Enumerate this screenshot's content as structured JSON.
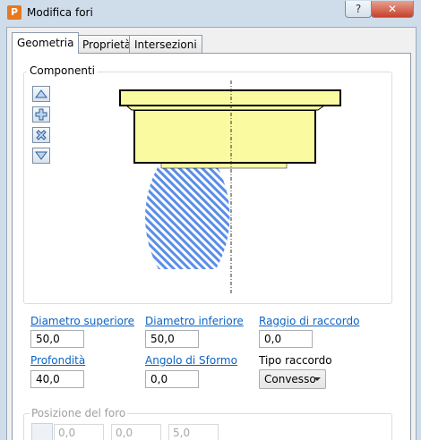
{
  "window": {
    "title": "Modifica fori",
    "app_icon_letter": "P",
    "help_label": "?",
    "close_label": "✕"
  },
  "tabs": [
    {
      "label": "Geometria",
      "active": true
    },
    {
      "label": "Proprietà",
      "active": false
    },
    {
      "label": "Intersezioni",
      "active": false
    }
  ],
  "componenti": {
    "label": "Componenti",
    "toolbar": [
      {
        "icon": "arrow-up-icon"
      },
      {
        "icon": "add-plus-icon"
      },
      {
        "icon": "delete-cross-icon"
      },
      {
        "icon": "arrow-down-icon"
      }
    ]
  },
  "fields": {
    "diametro_superiore": {
      "label": "Diametro superiore",
      "value": "50,0"
    },
    "diametro_inferiore": {
      "label": "Diametro inferiore",
      "value": "50,0"
    },
    "raggio_di_raccordo": {
      "label": "Raggio di raccordo",
      "value": "0,0"
    },
    "profondita": {
      "label": "Profondità",
      "value": "40,0"
    },
    "angolo_di_sformo": {
      "label": "Angolo di Sformo",
      "value": "0,0"
    },
    "tipo_raccordo": {
      "label": "Tipo raccordo",
      "value": "Convesso"
    }
  },
  "posizione": {
    "label": "Posizione del foro",
    "values": [
      "0,0",
      "0,0",
      "5,0"
    ]
  },
  "colors": {
    "component_fill": "#fafaa0",
    "hatch_blue": "#5a8ee6",
    "link_blue": "#0b63c4",
    "close_red": "#c7422c"
  }
}
